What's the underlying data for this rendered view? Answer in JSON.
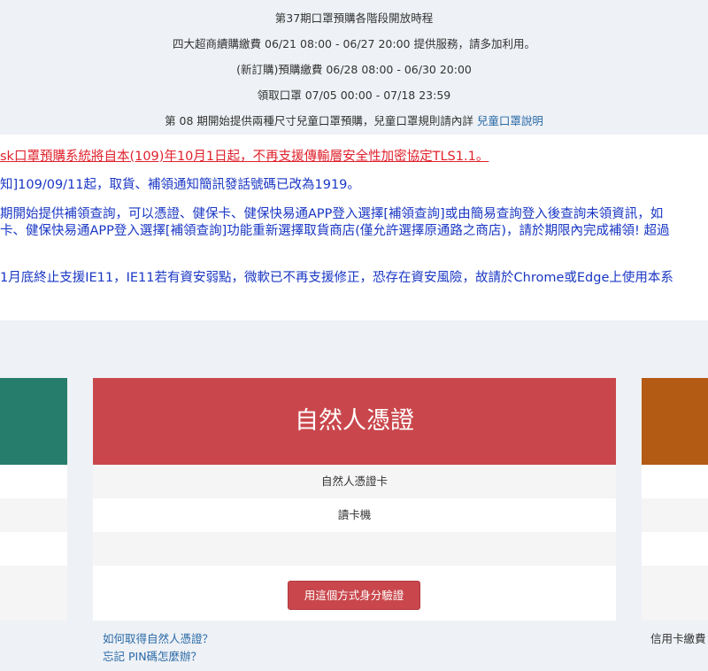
{
  "notice": {
    "line1": "第37期口罩預購各階段開放時程",
    "line2": "四大超商續購繳費 06/21 08:00 - 06/27 20:00 提供服務，請多加利用。",
    "line3": "(新訂購)預購繳費 06/28 08:00 - 06/30 20:00",
    "line4": "領取口罩 07/05 00:00 - 07/18 23:59",
    "line5_text": "第 08 期開始提供兩種尺寸兒童口罩預購，兒童口罩規則請內詳 ",
    "line5_link": "兒童口罩說明"
  },
  "alerts": {
    "red": "sk口罩預購系統將自本(109)年10月1日起，不再支援傳輸層安全性加密協定TLS1.1。",
    "blue1": "知]109/09/11起，取貨、補領通知簡訊發話號碼已改為1919。",
    "blue2": "期開始提供補領查詢，可以憑證、健保卡、健保快易通APP登入選擇[補領查詢]或由簡易查詢登入後查詢未領資訊，如",
    "blue3": "卡、健保快易通APP登入選擇[補領查詢]功能重新選擇取貨商店(僅允許選擇原通路之商店)，請於期限內完成補領! 超過",
    "blue4": "1月底終止支援IE11，IE11若有資安弱點，微軟已不再支援修正，恐存在資安風險，故請於Chrome或Edge上使用本系"
  },
  "card_main": {
    "title": "自然人憑證",
    "req1": "自然人憑證卡",
    "req2": "讀卡機",
    "button": "用這個方式身分驗證"
  },
  "links": {
    "how_to_get": "如何取得自然人憑證？",
    "forgot_pin": "忘記 PIN碼怎麼辦？"
  },
  "right_card": {
    "partial_text": "信用卡繳費"
  },
  "colors": {
    "left_card": "#267d6b",
    "main_card": "#c9474c",
    "right_card": "#b35a15"
  }
}
